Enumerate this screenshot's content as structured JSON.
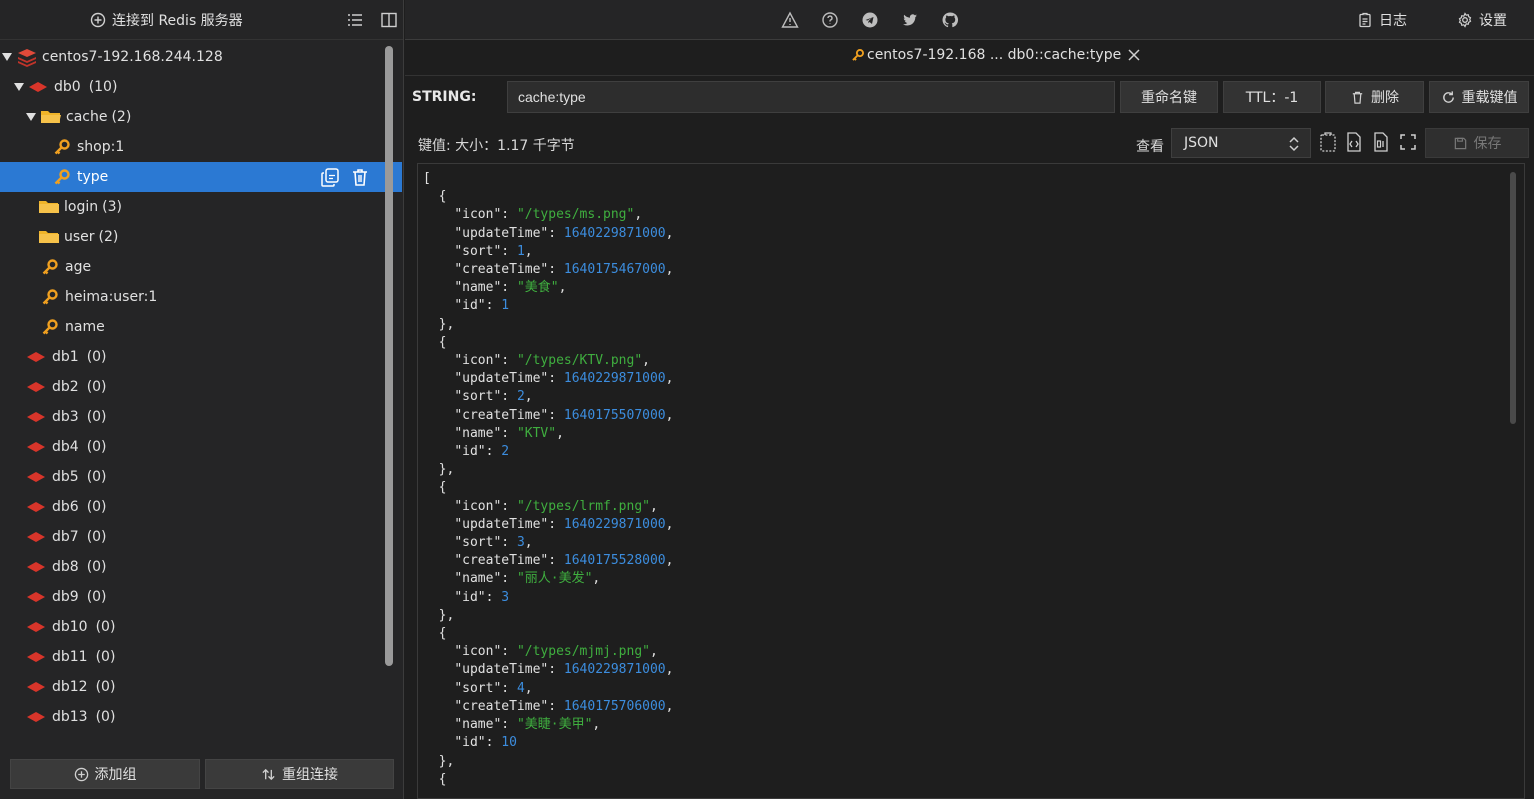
{
  "sidebar": {
    "connect_label": "连接到 Redis 服务器",
    "server": "centos7-192.168.244.128",
    "db0": {
      "name": "db0",
      "count": "(10)"
    },
    "folders": [
      {
        "name": "cache",
        "count": "(2)"
      },
      {
        "name": "login",
        "count": "(3)"
      },
      {
        "name": "user",
        "count": "(2)"
      }
    ],
    "cache_keys": [
      "shop:1",
      "type"
    ],
    "keys": [
      "age",
      "heima:user:1",
      "name"
    ],
    "dbs": [
      {
        "name": "db1",
        "count": "(0)"
      },
      {
        "name": "db2",
        "count": "(0)"
      },
      {
        "name": "db3",
        "count": "(0)"
      },
      {
        "name": "db4",
        "count": "(0)"
      },
      {
        "name": "db5",
        "count": "(0)"
      },
      {
        "name": "db6",
        "count": "(0)"
      },
      {
        "name": "db7",
        "count": "(0)"
      },
      {
        "name": "db8",
        "count": "(0)"
      },
      {
        "name": "db9",
        "count": "(0)"
      },
      {
        "name": "db10",
        "count": "(0)"
      },
      {
        "name": "db11",
        "count": "(0)"
      },
      {
        "name": "db12",
        "count": "(0)"
      },
      {
        "name": "db13",
        "count": "(0)"
      }
    ],
    "add_group_label": "添加组",
    "reorder_label": "重组连接"
  },
  "topbar": {
    "log_label": "日志",
    "settings_label": "设置"
  },
  "tab": {
    "title": "centos7-192.168 ... db0::cache:type"
  },
  "key_bar": {
    "type": "STRING:",
    "key_value": "cache:type",
    "rename_label": "重命名键",
    "ttl_label": "TTL：-1",
    "delete_label": "删除",
    "reload_label": "重载键值"
  },
  "value_bar": {
    "size_label": "键值: 大小：1.17 千字节",
    "view_label": "查看",
    "view_format": "JSON",
    "save_label": "保存"
  },
  "value": [
    {
      "icon": "/types/ms.png",
      "updateTime": 1640229871000,
      "sort": 1,
      "createTime": 1640175467000,
      "name": "美食",
      "id": 1
    },
    {
      "icon": "/types/KTV.png",
      "updateTime": 1640229871000,
      "sort": 2,
      "createTime": 1640175507000,
      "name": "KTV",
      "id": 2
    },
    {
      "icon": "/types/lrmf.png",
      "updateTime": 1640229871000,
      "sort": 3,
      "createTime": 1640175528000,
      "name": "丽人·美发",
      "id": 3
    },
    {
      "icon": "/types/mjmj.png",
      "updateTime": 1640229871000,
      "sort": 4,
      "createTime": 1640175706000,
      "name": "美睫·美甲",
      "id": 10
    }
  ],
  "colors": {
    "accent": "#2b79d3",
    "redis_red": "#d8352a",
    "folder": "#f0b429",
    "key": "#f0a020",
    "json_string": "#3fae3f",
    "json_number": "#3c8dde"
  },
  "icons": {
    "toolbar": [
      "warning-icon",
      "help-icon",
      "telegram-icon",
      "twitter-icon",
      "github-icon"
    ],
    "format": [
      "copy-icon",
      "code-icon",
      "binary-icon",
      "fullscreen-icon"
    ]
  }
}
